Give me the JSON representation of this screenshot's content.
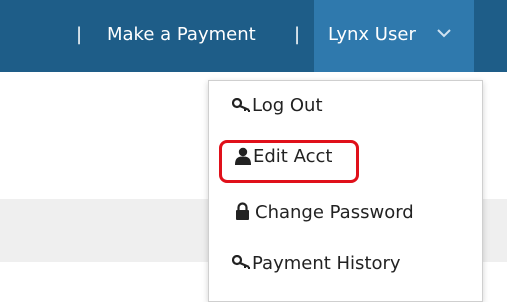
{
  "navbar": {
    "separator": "|",
    "make_payment": "Make a Payment",
    "user_name": "Lynx User",
    "bg_color": "#1e5d88",
    "active_color": "#2f79ad",
    "chevron_icon": "chevron-down-icon"
  },
  "dropdown": {
    "items": [
      {
        "label": "Log Out",
        "icon": "key-icon"
      },
      {
        "label": "Edit Acct",
        "icon": "user-icon",
        "highlighted": true,
        "highlight_color": "#e0101a"
      },
      {
        "label": "Change Password",
        "icon": "lock-icon"
      },
      {
        "label": "Payment History",
        "icon": "key-icon"
      }
    ]
  }
}
